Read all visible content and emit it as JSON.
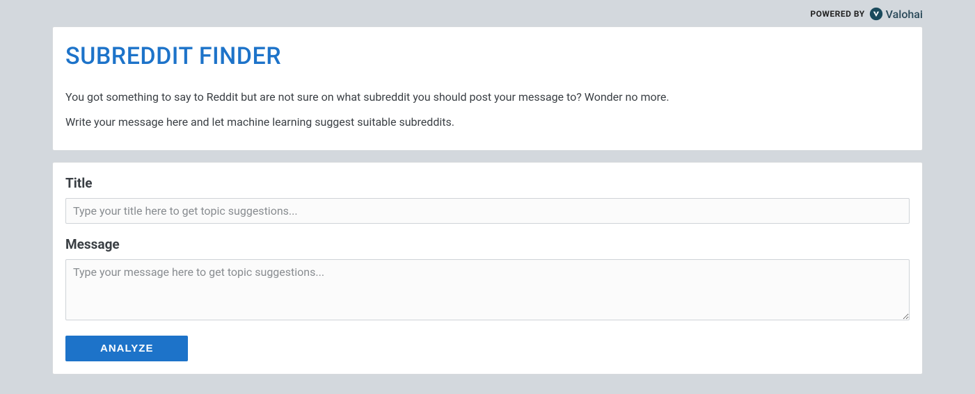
{
  "poweredBy": {
    "label": "POWERED BY",
    "brand": "Valohai"
  },
  "header": {
    "title": "SUBREDDIT FINDER",
    "intro1": "You got something to say to Reddit but are not sure on what subreddit you should post your message to? Wonder no more.",
    "intro2": "Write your message here and let machine learning suggest suitable subreddits."
  },
  "form": {
    "titleLabel": "Title",
    "titlePlaceholder": "Type your title here to get topic suggestions...",
    "messageLabel": "Message",
    "messagePlaceholder": "Type your message here to get topic suggestions...",
    "analyzeLabel": "ANALYZE"
  }
}
